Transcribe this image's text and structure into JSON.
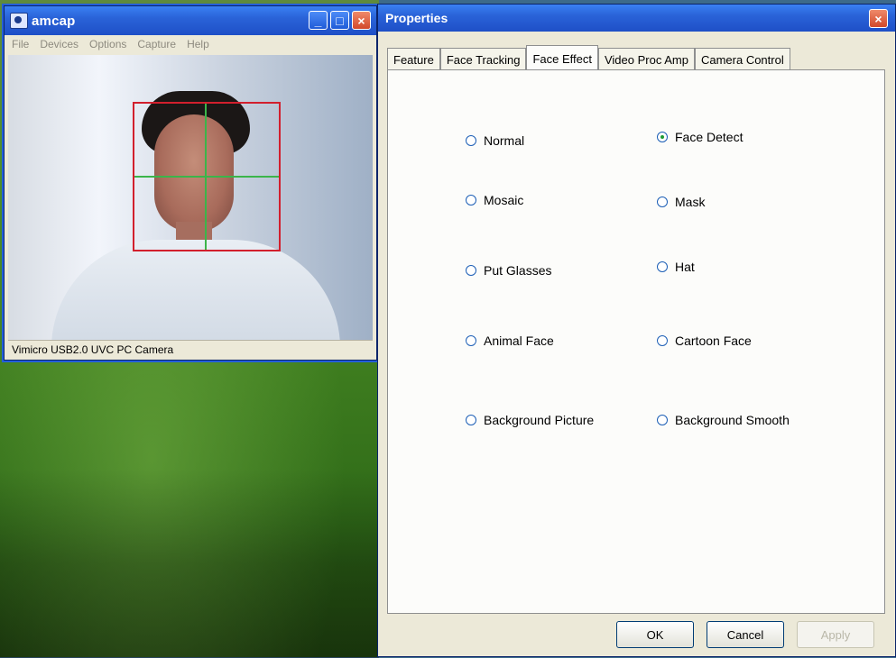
{
  "amcap_window": {
    "title": "amcap",
    "menu": [
      "File",
      "Devices",
      "Options",
      "Capture",
      "Help"
    ],
    "status_text": "Vimicro USB2.0 UVC PC Camera"
  },
  "properties_dialog": {
    "title": "Properties",
    "tabs": [
      {
        "label": "Feature",
        "active": false
      },
      {
        "label": "Face Tracking",
        "active": false
      },
      {
        "label": "Face Effect",
        "active": true
      },
      {
        "label": "Video Proc Amp",
        "active": false
      },
      {
        "label": "Camera Control",
        "active": false
      }
    ],
    "options": [
      {
        "label": "Normal",
        "checked": false
      },
      {
        "label": "Face Detect",
        "checked": true
      },
      {
        "label": "Mosaic",
        "checked": false
      },
      {
        "label": "Mask",
        "checked": false
      },
      {
        "label": "Put Glasses",
        "checked": false
      },
      {
        "label": "Hat",
        "checked": false
      },
      {
        "label": "Animal Face",
        "checked": false
      },
      {
        "label": "Cartoon Face",
        "checked": false
      },
      {
        "label": "Background Picture",
        "checked": false
      },
      {
        "label": "Background Smooth",
        "checked": false
      }
    ],
    "buttons": {
      "ok": "OK",
      "cancel": "Cancel",
      "apply": "Apply"
    }
  },
  "icons": {
    "minimize": "minimize-icon",
    "maximize": "maximize-icon",
    "close": "close-icon"
  }
}
